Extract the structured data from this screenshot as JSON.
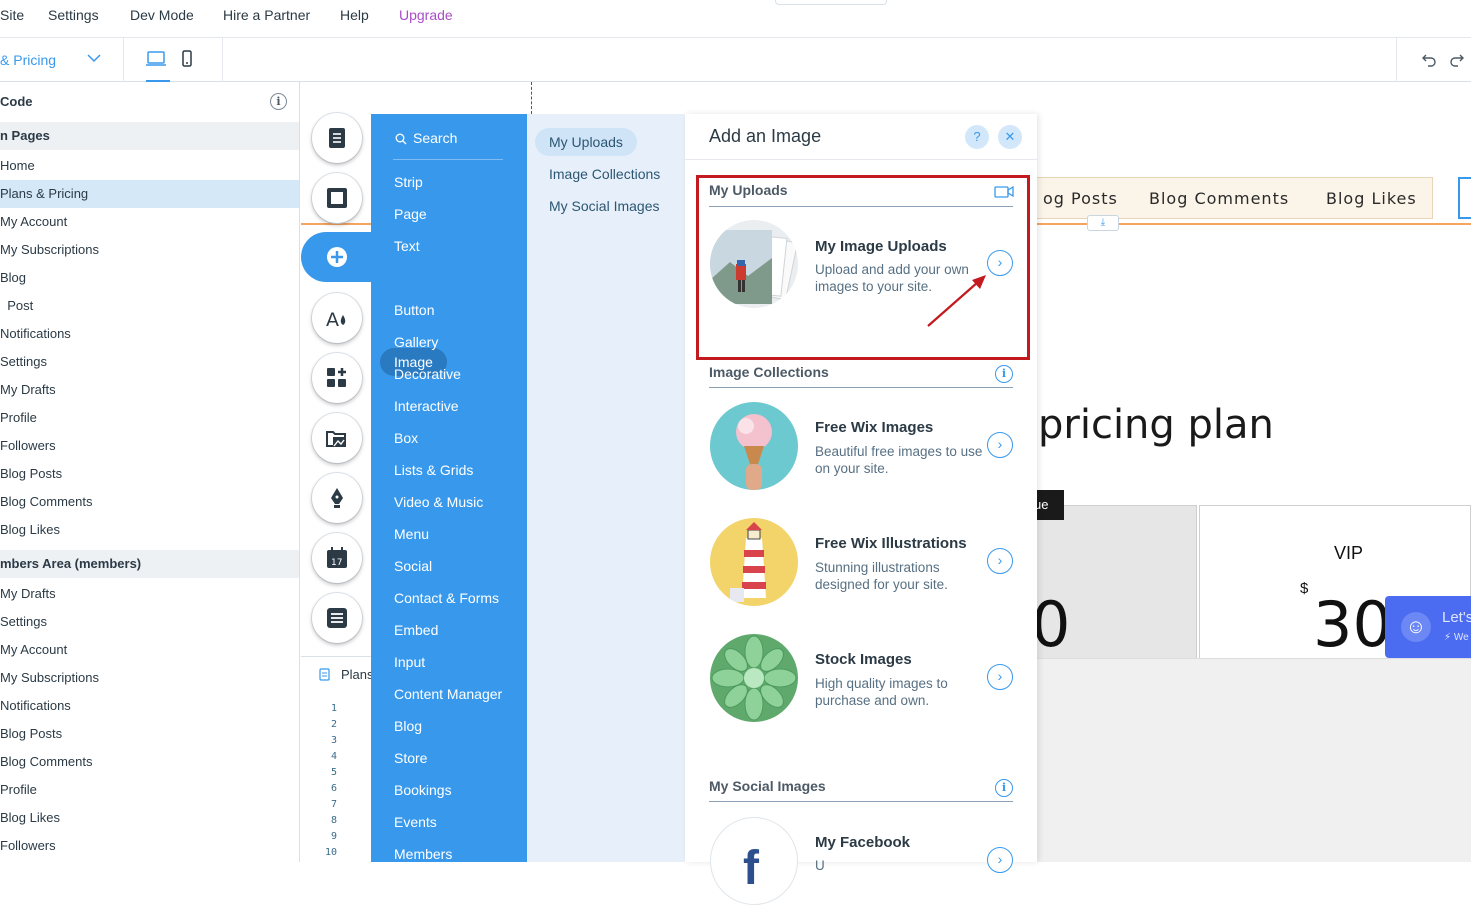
{
  "topbar": {
    "items": [
      "Site",
      "Settings",
      "Dev Mode",
      "Hire a Partner",
      "Help"
    ],
    "upgrade": "Upgrade"
  },
  "toolbar": {
    "page_selector": "& Pricing"
  },
  "pages_panel": {
    "code_label": "Code",
    "main_pages_header": "n Pages",
    "main_pages": [
      "Home",
      "Plans & Pricing",
      "My Account",
      "My Subscriptions",
      "Blog",
      "  Post",
      "Notifications",
      "Settings",
      "My Drafts",
      "Profile",
      "Followers",
      "Blog Posts",
      "Blog Comments",
      "Blog Likes"
    ],
    "members_header": "mbers Area (members)",
    "members_pages": [
      "My Drafts",
      "Settings",
      "My Account",
      "My Subscriptions",
      "Notifications",
      "Blog Posts",
      "Blog Comments",
      "Profile",
      "Blog Likes",
      "Followers"
    ]
  },
  "code_panel": {
    "tab_label": "Plans",
    "line_numbers": [
      "1",
      "2",
      "3",
      "4",
      "5",
      "6",
      "7",
      "8",
      "9",
      "10"
    ]
  },
  "canvas": {
    "menu_items": [
      "og Posts",
      "Blog Comments",
      "Blog Likes"
    ],
    "heading": "pricing plan",
    "badge": "ue",
    "left_card_price": "0",
    "vip_title": "VIP",
    "vip_currency": "$",
    "vip_price": "30",
    "chat_text": "Let's",
    "chat_sub": "We"
  },
  "add_panel": {
    "search_label": "Search",
    "categories": [
      "Strip",
      "Page",
      "Text",
      "Image",
      "Button",
      "Gallery",
      "Decorative",
      "Interactive",
      "Box",
      "Lists & Grids",
      "Video & Music",
      "Menu",
      "Social",
      "Contact & Forms",
      "Embed",
      "Input",
      "Content Manager",
      "Blog",
      "Store",
      "Bookings",
      "Events",
      "Members"
    ],
    "active_category": "Image",
    "subcategories": [
      "My Uploads",
      "Image Collections",
      "My Social Images"
    ],
    "active_subcategory": "My Uploads",
    "title": "Add an Image",
    "help": "?",
    "close": "✕",
    "sections": {
      "uploads_title": "My Uploads",
      "uploads_item_title": "My Image Uploads",
      "uploads_item_desc": "Upload and add your own images to your site.",
      "collections_title": "Image Collections",
      "collections": [
        {
          "title": "Free Wix Images",
          "desc": "Beautiful free images to use on your site."
        },
        {
          "title": "Free Wix Illustrations",
          "desc": "Stunning illustrations designed for your site."
        },
        {
          "title": "Stock Images",
          "desc": "High quality images to purchase and own."
        }
      ],
      "social_title": "My Social Images",
      "social_item_title": "My Facebook",
      "social_item_desc": "U"
    }
  },
  "colors": {
    "accent": "#3899ec",
    "upgrade": "#aa4dc8",
    "highlight": "#c21a1f"
  }
}
